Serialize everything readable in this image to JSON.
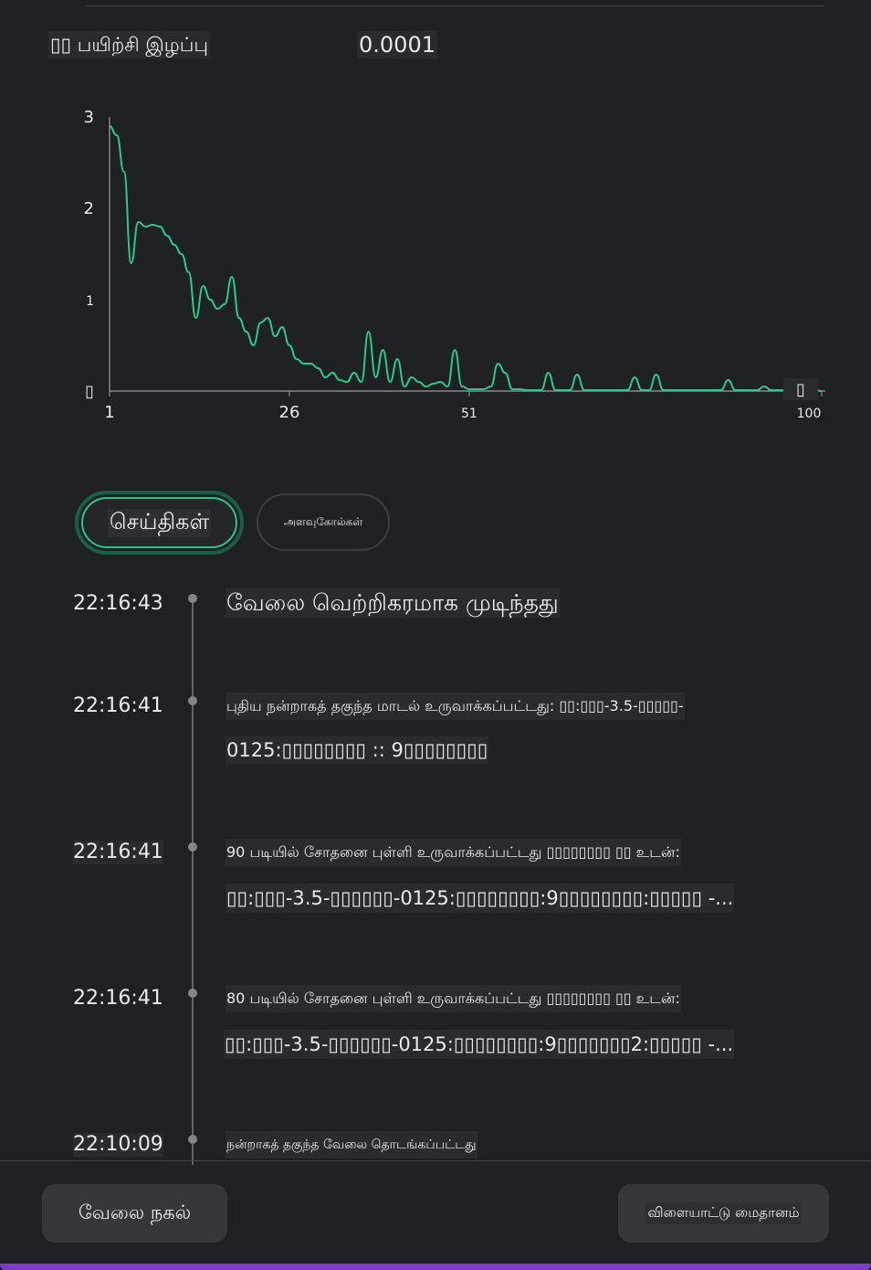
{
  "stat": {
    "label": "▯▯ பயிற்சி இழப்பு",
    "value": "0.0001"
  },
  "chart_data": {
    "type": "line",
    "y_ticks": [
      "3",
      "2",
      "1",
      "▯"
    ],
    "x_ticks": [
      "1",
      "26",
      "51",
      "100"
    ],
    "ylim": [
      0,
      3
    ],
    "xlim": [
      1,
      100
    ],
    "marker_label": "▯",
    "line_color": "#2ec98a",
    "series": [
      {
        "values": [
          2.9,
          2.8,
          2.4,
          1.4,
          1.85,
          1.8,
          1.82,
          1.8,
          1.7,
          1.6,
          1.5,
          1.3,
          0.8,
          1.15,
          1.0,
          0.9,
          0.95,
          1.25,
          0.8,
          0.65,
          0.5,
          0.75,
          0.8,
          0.6,
          0.7,
          0.5,
          0.35,
          0.3,
          0.3,
          0.25,
          0.15,
          0.2,
          0.12,
          0.1,
          0.2,
          0.1,
          0.65,
          0.15,
          0.45,
          0.1,
          0.35,
          0.05,
          0.15,
          0.1,
          0.05,
          0.08,
          0.1,
          0.05,
          0.45,
          0.05,
          0.02,
          0.02,
          0.02,
          0.05,
          0.3,
          0.2,
          0.02,
          0.02,
          0.01,
          0.01,
          0.01,
          0.2,
          0.01,
          0.01,
          0.01,
          0.18,
          0.01,
          0.01,
          0.01,
          0.01,
          0.01,
          0.01,
          0.01,
          0.15,
          0.01,
          0.01,
          0.18,
          0.01,
          0.01,
          0.01,
          0.01,
          0.01,
          0.01,
          0.01,
          0.01,
          0.01,
          0.12,
          0.01,
          0.01,
          0.01,
          0.01,
          0.05,
          0.01,
          0.01,
          0.01,
          0.01,
          0.01,
          0.01,
          0.01,
          0.0
        ]
      }
    ]
  },
  "tabs": {
    "messages": "செய்திகள்",
    "metrics": "அளவுகோல்கள்"
  },
  "events": [
    {
      "time": "22:16:43",
      "lines": [
        "வேலை வெற்றிகரமாக முடிந்தது"
      ]
    },
    {
      "time": "22:16:41",
      "lines": [
        "புதிய நன்றாகத் தகுந்த மாடல் உருவாக்கப்பட்டது: ▯▯:▯▯▯-3.5-▯▯▯▯▯-",
        "0125:▯▯▯▯▯▯▯▯ :: 9▯▯▯▯▯▯▯▯"
      ]
    },
    {
      "time": "22:16:41",
      "lines": [
        "90 படியில் சோதனை புள்ளி உருவாக்கப்பட்டது ▯▯▯▯▯▯▯▯ ▯▯ உடன்:",
        "▯▯:▯▯▯-3.5-▯▯▯▯▯▯-0125:▯▯▯▯▯▯▯▯:9▯▯▯▯▯▯▯▯:▯▯▯▯▯ -..."
      ]
    },
    {
      "time": "22:16:41",
      "lines": [
        "80 படியில் சோதனை புள்ளி உருவாக்கப்பட்டது ▯▯▯▯▯▯▯▯ ▯▯ உடன்:",
        "▯▯:▯▯▯-3.5-▯▯▯▯▯▯-0125:▯▯▯▯▯▯▯▯:9▯▯▯▯▯▯▯2:▯▯▯▯▯ -..."
      ]
    },
    {
      "time": "22:10:09",
      "lines": [
        "நன்றாகத் தகுந்த வேலை தொடங்கப்பட்டது"
      ]
    }
  ],
  "buttons": {
    "copy_job": "வேலை நகல்",
    "playground": "விளையாட்டு மைதானம்"
  }
}
